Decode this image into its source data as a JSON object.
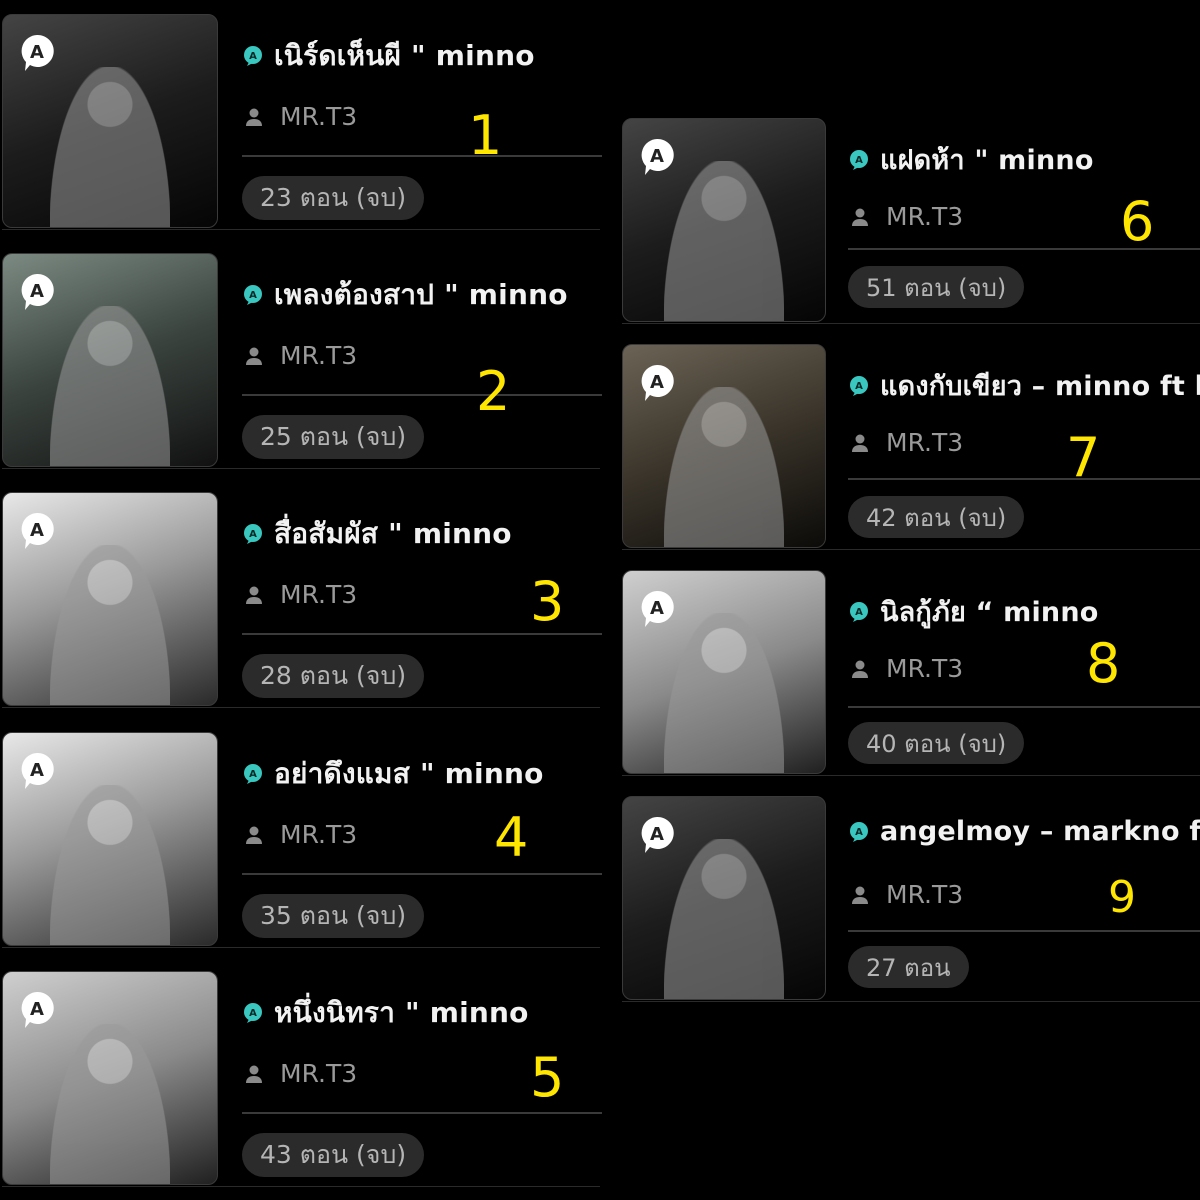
{
  "colors": {
    "background": "#000000",
    "number": "#ffe600",
    "chat_icon": "#39c7c0",
    "chip_bg": "#2b2b2b"
  },
  "icons": {
    "badge": "a-speech-bubble-icon",
    "title": "chat-bubble-icon",
    "author": "user-icon"
  },
  "stories": [
    {
      "index": "1",
      "title": "เนิร์ดเห็นผี \" minno",
      "author": "MR.T3",
      "episodes": "23 ตอน (จบ)"
    },
    {
      "index": "2",
      "title": "เพลงต้องสาป \" minno",
      "author": "MR.T3",
      "episodes": "25 ตอน (จบ)"
    },
    {
      "index": "3",
      "title": "สื่อสัมผัส \" minno",
      "author": "MR.T3",
      "episodes": "28 ตอน (จบ)"
    },
    {
      "index": "4",
      "title": "อย่าดึงแมส \" minno",
      "author": "MR.T3",
      "episodes": "35 ตอน (จบ)"
    },
    {
      "index": "5",
      "title": "หนึ่งนิทรา \" minno",
      "author": "MR.T3",
      "episodes": "43 ตอน (จบ)"
    },
    {
      "index": "6",
      "title": "แฝดห้า \" minno",
      "author": "MR.T3",
      "episodes": "51 ตอน (จบ)"
    },
    {
      "index": "7",
      "title": "แดงกับเขียว – minno ft h",
      "author": "MR.T3",
      "episodes": "42 ตอน (จบ)"
    },
    {
      "index": "8",
      "title": "นิลกู้ภัย “ minno",
      "author": "MR.T3",
      "episodes": "40 ตอน (จบ)"
    },
    {
      "index": "9",
      "title": "angelmoy – markno ft n",
      "author": "MR.T3",
      "episodes": "27 ตอน"
    }
  ]
}
